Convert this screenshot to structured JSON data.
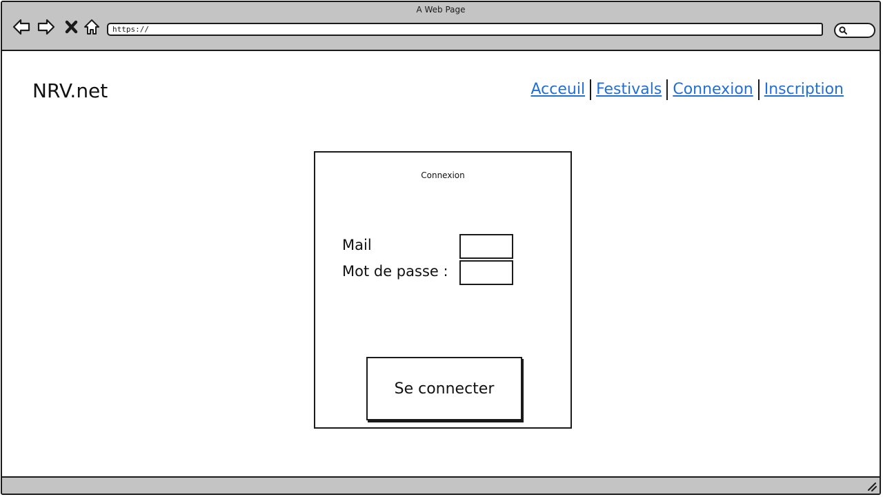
{
  "window": {
    "title": "A Web Page"
  },
  "browser": {
    "url": "https://",
    "icons": {
      "back": "back-arrow-icon",
      "forward": "forward-arrow-icon",
      "stop": "close-icon",
      "home": "home-icon",
      "search": "search-icon",
      "resize": "resize-grip-icon"
    }
  },
  "site": {
    "logo": "NRV.net",
    "nav": [
      {
        "label": "Acceuil"
      },
      {
        "label": "Festivals"
      },
      {
        "label": "Connexion"
      },
      {
        "label": "Inscription"
      }
    ]
  },
  "login": {
    "title": "Connexion",
    "mail_label": "Mail",
    "mail_value": "",
    "password_label": "Mot de passe :",
    "password_value": "",
    "submit_label": "Se connecter"
  },
  "colors": {
    "chrome": "#c4c4c4",
    "link": "#1f6fd6",
    "ink": "#1a1a1a"
  }
}
